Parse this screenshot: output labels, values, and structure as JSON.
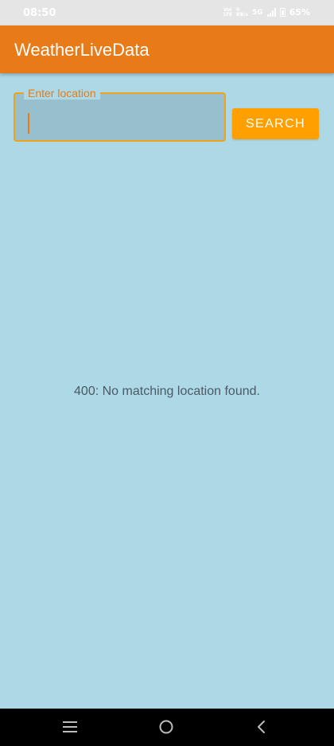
{
  "status_bar": {
    "time": "08:50",
    "volte_top": "VoI",
    "volte_bottom": "LTE",
    "speed_top": "0",
    "speed_bottom": "KB/s",
    "network": "5G",
    "battery": "65%",
    "icons": [
      "signal-icon",
      "battery-icon"
    ]
  },
  "app_bar": {
    "title": "WeatherLiveData",
    "color": "#E87B18"
  },
  "search": {
    "label": "Enter location",
    "value": "",
    "placeholder": "",
    "button_label": "SEARCH",
    "accent_color": "#FFA000"
  },
  "result": {
    "message": "400: No matching location found."
  },
  "navigation": {
    "icons": [
      "recents-icon",
      "home-icon",
      "back-icon"
    ]
  },
  "colors": {
    "background": "#ADD8E6",
    "status_bar": "#E5E5E5",
    "nav_bar": "#000000"
  }
}
